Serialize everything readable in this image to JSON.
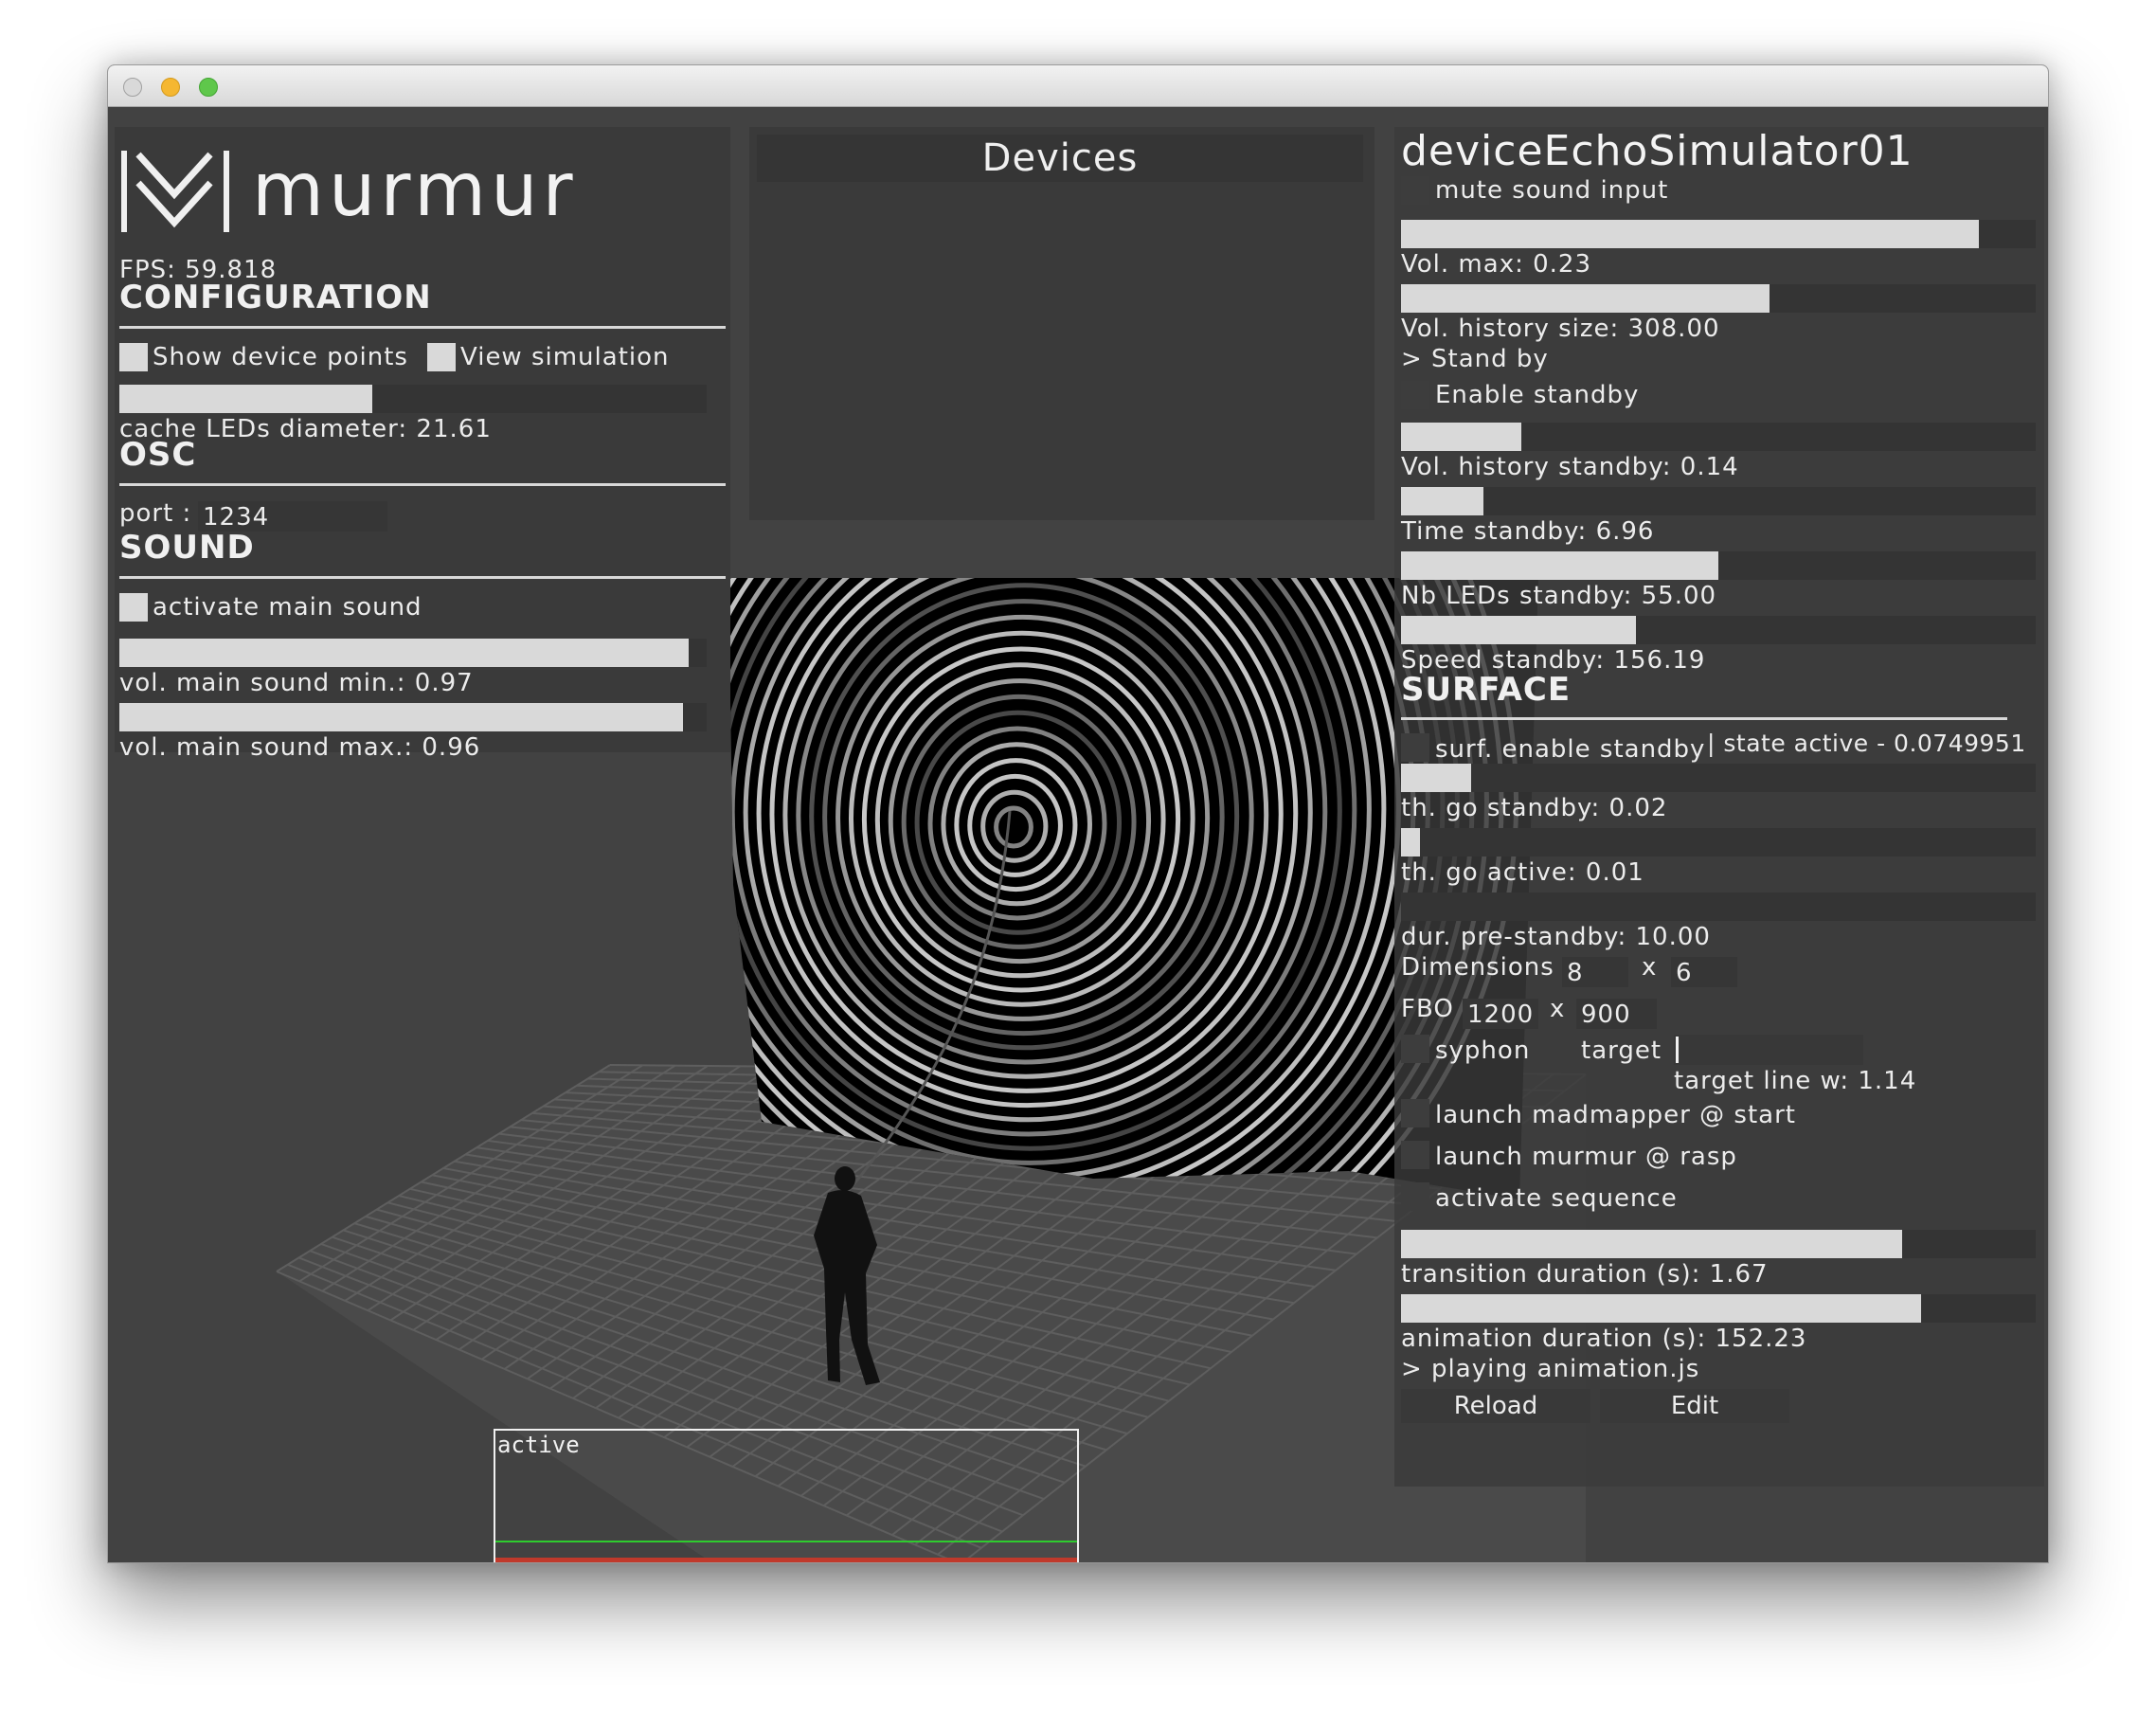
{
  "app": {
    "name": "murmur",
    "fps_label": "FPS: 59.818"
  },
  "left": {
    "configuration": {
      "title": "CONFIGURATION",
      "show_device_points": "Show device points",
      "view_simulation": "View simulation",
      "cache_leds_label": "cache LEDs diameter: 21.61",
      "cache_leds_fill": 0.43
    },
    "osc": {
      "title": "OSC",
      "port_label": "port :",
      "port_value": "1234"
    },
    "sound": {
      "title": "SOUND",
      "activate_main_sound": "activate main sound",
      "vol_min_label": "vol. main sound min.: 0.97",
      "vol_min_fill": 0.97,
      "vol_max_label": "vol. main sound max.: 0.96",
      "vol_max_fill": 0.96
    }
  },
  "devices": {
    "title": "Devices"
  },
  "device": {
    "name": "deviceEchoSimulator01",
    "mute_sound_input": "mute sound input",
    "vol_max": {
      "label": "Vol. max: 0.23",
      "fill": 0.91
    },
    "vol_history_size": {
      "label": "Vol. history size: 308.00",
      "fill": 0.58
    },
    "standby_header": "> Stand by",
    "enable_standby": "Enable standby",
    "vol_history_standby": {
      "label": "Vol. history standby: 0.14",
      "fill": 0.19
    },
    "time_standby": {
      "label": "Time standby: 6.96",
      "fill": 0.13
    },
    "nb_leds_standby": {
      "label": "Nb LEDs standby: 55.00",
      "fill": 0.5
    },
    "speed_standby": {
      "label": "Speed standby: 156.19",
      "fill": 0.37
    },
    "surface": {
      "title": "SURFACE",
      "surf_enable_standby": "surf. enable standby",
      "state": "| state active - 0.0749951",
      "th_go_standby": {
        "label": "th. go standby: 0.02",
        "fill": 0.11
      },
      "th_go_active": {
        "label": "th. go active: 0.01",
        "fill": 0.03
      },
      "dur_pre_standby": {
        "label": "dur. pre-standby: 10.00",
        "fill": 0.0
      },
      "dimensions_label": "Dimensions",
      "dim_w": "8",
      "dim_x": "x",
      "dim_h": "6",
      "fbo_label": "FBO",
      "fbo_w": "1200",
      "fbo_x": "x",
      "fbo_h": "900",
      "syphon": "syphon",
      "target": "target",
      "target_line": "target line w: 1.14",
      "launch_madmapper": "launch madmapper @ start",
      "launch_murmur": "launch murmur @ rasp",
      "activate_sequence": "activate sequence",
      "transition_duration": {
        "label": "transition duration (s): 1.67",
        "fill": 0.79
      },
      "animation_duration": {
        "label": "animation duration (s): 152.23",
        "fill": 0.82
      },
      "playing": "> playing animation.js",
      "reload": "Reload",
      "edit": "Edit"
    }
  },
  "graph": {
    "label": "active"
  },
  "colors": {
    "panel": "#3a3a3a",
    "background": "#424242",
    "fill": "#d9d9d9",
    "graph_green": "#2ecc2e",
    "graph_red": "#c0392b"
  }
}
